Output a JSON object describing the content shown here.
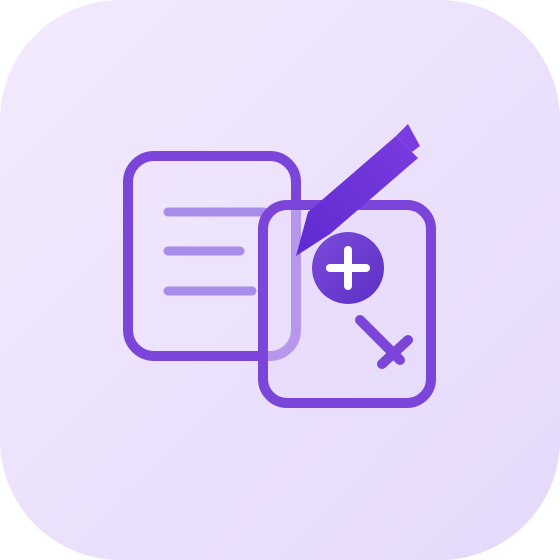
{
  "icon": {
    "name": "document-edit-app-icon",
    "background_gradient": [
      "#F3EAFD",
      "#E5D9FA"
    ],
    "primary_color": "#7A45D8",
    "dark_color": "#6A2FD6",
    "line_color": "#A98BEA",
    "glyph_color": "#FFFFFF",
    "symbols": {
      "plus": "+",
      "multiply": "×"
    }
  }
}
